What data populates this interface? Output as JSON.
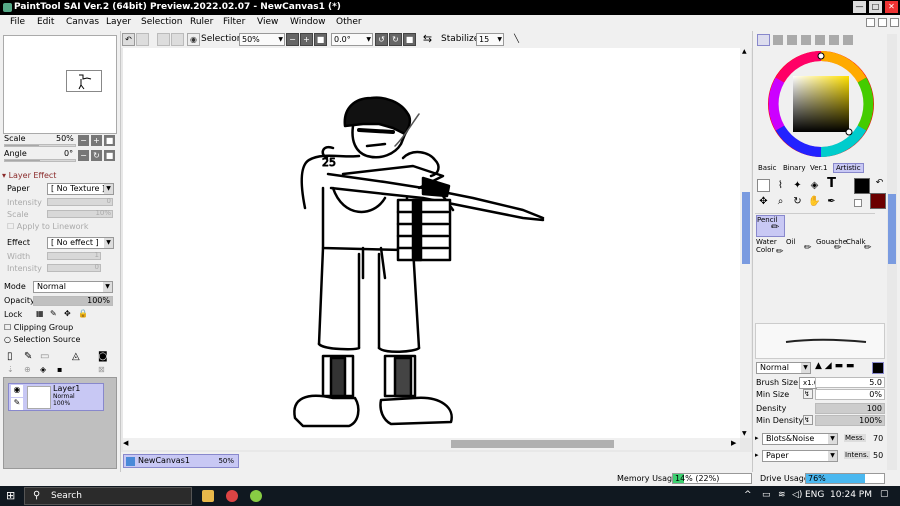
{
  "window": {
    "title": "PaintTool SAI Ver.2 (64bit) Preview.2022.02.07 - NewCanvas1 (*)",
    "min": "—",
    "max": "□",
    "close": "✕"
  },
  "menu": [
    "File",
    "Edit",
    "Canvas",
    "Layer",
    "Selection",
    "Ruler",
    "Filter",
    "View",
    "Window",
    "Other"
  ],
  "toolbar": {
    "selection_label": "Selection",
    "zoom": "50%",
    "rotation": "0.0°",
    "stabilizer_label": "Stabilizer",
    "stabilizer": "15"
  },
  "left": {
    "scale_label": "Scale",
    "scale_value": "50%",
    "angle_label": "Angle",
    "angle_value": "0°",
    "layer_effect_label": "Layer Effect",
    "paper_label": "Paper",
    "paper_value": "[ No Texture ]",
    "intensity_label": "Intensity",
    "intensity_value": "0",
    "scale2_label": "Scale",
    "scale2_value": "10%",
    "apply_linework": "Apply to Linework",
    "effect_label": "Effect",
    "effect_value": "[ No effect ]",
    "width_label": "Width",
    "width_value": "1",
    "intensity2_label": "Intensity",
    "intensity2_value": "0",
    "mode_label": "Mode",
    "mode_value": "Normal",
    "opacity_label": "Opacity",
    "opacity_value": "100%",
    "opacity_level": 1.0,
    "lock_label": "Lock",
    "clipping_group": "Clipping Group",
    "selection_source": "Selection Source",
    "layer": {
      "name": "Layer1",
      "mode": "Normal",
      "opacity": "100%"
    }
  },
  "canvas_tab": {
    "name": "NewCanvas1",
    "zoom": "50%"
  },
  "right": {
    "color_tabs": [
      "Basic",
      "Binary",
      "Ver.1",
      "Artistic"
    ],
    "primary_color": "#000000",
    "secondary_color": "#6b0000",
    "brushes": [
      {
        "name": "Pencil"
      },
      {
        "name": "Water Color"
      },
      {
        "name": "Oil"
      },
      {
        "name": "Gouache"
      },
      {
        "name": "Chalk"
      }
    ],
    "blend_mode": "Normal",
    "brush_size_label": "Brush Size",
    "brush_size_mult": "x1.0",
    "brush_size": "5.0",
    "min_size_label": "Min Size",
    "min_size": "0%",
    "density_label": "Density",
    "density": "100",
    "min_density_label": "Min Density",
    "min_density": "100%",
    "texture1": "Blots&Noise",
    "texture1_label": "Mess.",
    "texture1_value": "70",
    "texture2": "Paper",
    "texture2_label": "Intens.",
    "texture2_value": "50"
  },
  "status": {
    "memory_label": "Memory Usage",
    "memory_value": "14% (22%)",
    "memory_level": 0.14,
    "drive_label": "Drive Usage",
    "drive_value": "76%",
    "drive_level": 0.76
  },
  "taskbar": {
    "search": "Search",
    "lang": "ENG",
    "time": "10:24 PM"
  }
}
